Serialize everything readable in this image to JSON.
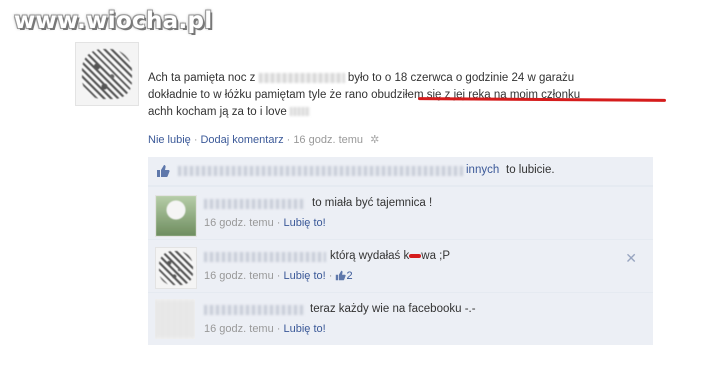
{
  "watermark": "www.wiocha.pl",
  "post": {
    "line1_a": "Ach ta pamięta noc z",
    "line1_b": "było to o 18 czerwca o godzinie 24 w garażu",
    "line2_a": "dokładnie to w łóżku pamiętam tyle że rano",
    "line2_b": "obudziłem się z jej reką na moim członku",
    "line3": "achh kocham ją za to i love",
    "unlike": "Nie lubię",
    "add_comment": "Dodaj komentarz",
    "time": "16 godz. temu"
  },
  "likes": {
    "others": "innych",
    "suffix": "to lubicie."
  },
  "comments": [
    {
      "text": "to miała być tajemnica !",
      "time": "16 godz. temu",
      "like": "Lubię to!"
    },
    {
      "text": "którą wydałaś k",
      "text_suffix": "wa ;P",
      "time": "16 godz. temu",
      "like": "Lubię to!",
      "likes_count": "2"
    },
    {
      "text": "teraz każdy wie na facebooku -.-",
      "time": "16 godz. temu",
      "like": "Lubię to!"
    }
  ],
  "colors": {
    "link": "#3b5998",
    "meta": "#999999",
    "comment_bg": "#eceff5",
    "underline": "#d51c1c"
  },
  "icons": [
    "thumbs-up-icon",
    "gear-icon",
    "close-icon"
  ]
}
